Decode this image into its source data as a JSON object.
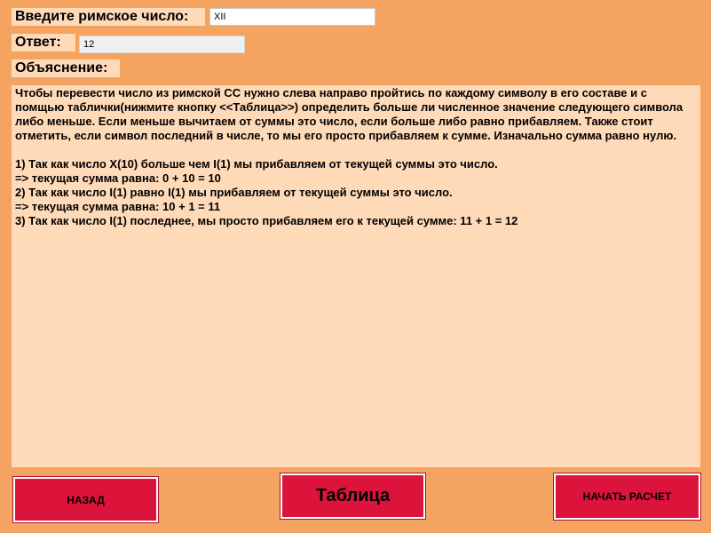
{
  "form": {
    "roman_label": "Введите римское число:",
    "roman_value": "XII",
    "answer_label": "Ответ:",
    "answer_value": "12",
    "explanation_label": "Объяснение:"
  },
  "explanation": {
    "intro": "Чтобы перевести число из римской СС нужно слева направо пройтись по каждому символу в его составе и с помщью таблички(нижмите кнопку <<Таблица>>) определить больше ли численное значение следующего символа либо меньше. Если меньше вычитаем от суммы это число, если больше либо равно прибавляем. Также стоит отметить, если символ последний в числе, то мы его просто прибавляем к сумме. Изначально сумма равно нулю.",
    "steps": [
      "1) Так как число X(10) больше чем I(1) мы прибавляем от текущей суммы это число.",
      "=> текущая сумма равна: 0 + 10 = 10",
      "2) Так как число I(1) равно I(1) мы прибавляем от текущей суммы это число.",
      "=> текущая сумма равна: 10 + 1 = 11",
      "3) Так как число I(1) последнее, мы просто прибавляем его к текущей сумме: 11 + 1 = 12"
    ]
  },
  "buttons": {
    "back": "НАЗАД",
    "table": "Таблица",
    "start": "НАЧАТЬ РАСЧЕТ"
  },
  "colors": {
    "background": "#f4a460",
    "panel": "#ffdab9",
    "button": "#dc143c"
  }
}
